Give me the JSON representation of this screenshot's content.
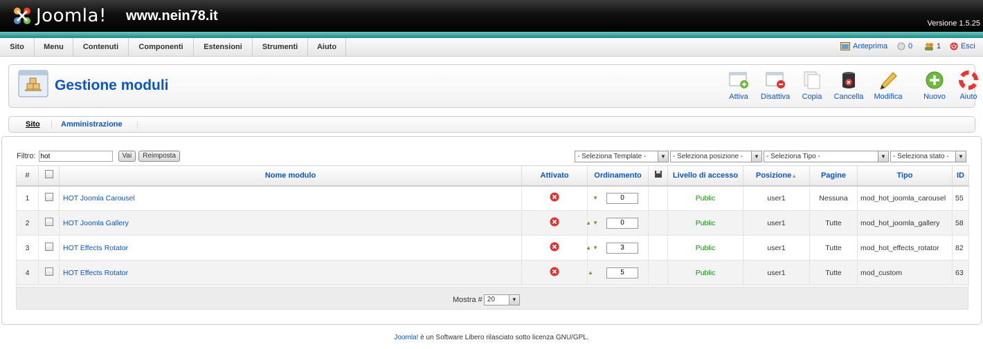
{
  "header": {
    "brand": "Joomla!",
    "site": "www.nein78.it",
    "version": "Versione 1.5.25"
  },
  "menu": [
    "Sito",
    "Menu",
    "Contenuti",
    "Componenti",
    "Estensioni",
    "Strumenti",
    "Aiuto"
  ],
  "status": {
    "preview": "Anteprima",
    "messages": "0",
    "users": "1",
    "logout": "Esci"
  },
  "toolbar": {
    "title": "Gestione moduli",
    "buttons": [
      "Attiva",
      "Disattiva",
      "Copia",
      "Cancella",
      "Modifica",
      "Nuovo",
      "Aiuto"
    ]
  },
  "subtabs": [
    "Sito",
    "Amministrazione"
  ],
  "filter": {
    "label": "Filtro:",
    "value": "hot",
    "go": "Vai",
    "reset": "Reimposta"
  },
  "selects": [
    "- Seleziona Template -",
    "- Seleziona posizione -",
    "- Seleziona Tipo -",
    "- Seleziona stato -"
  ],
  "columns": [
    "#",
    "",
    "Nome modulo",
    "Attivato",
    "Ordinamento",
    "",
    "Livello di accesso",
    "Posizione",
    "Pagine",
    "Tipo",
    "ID"
  ],
  "rows": [
    {
      "n": "1",
      "name": "HOT Joomla Carousel",
      "order": "0",
      "access": "Public",
      "pos": "user1",
      "pages": "Nessuna",
      "type": "mod_hot_joomla_carousel",
      "id": "55"
    },
    {
      "n": "2",
      "name": "HOT Joomla Gallery",
      "order": "0",
      "access": "Public",
      "pos": "user1",
      "pages": "Tutte",
      "type": "mod_hot_joomla_gallery",
      "id": "58"
    },
    {
      "n": "3",
      "name": "HOT Effects Rotator",
      "order": "3",
      "access": "Public",
      "pos": "user1",
      "pages": "Tutte",
      "type": "mod_hot_effects_rotator",
      "id": "82"
    },
    {
      "n": "4",
      "name": "HOT Effects Rotator",
      "order": "5",
      "access": "Public",
      "pos": "user1",
      "pages": "Tutte",
      "type": "mod_custom",
      "id": "63"
    }
  ],
  "footer": {
    "show_label": "Mostra #",
    "show_value": "20"
  },
  "copyright": {
    "link": "Joomla!",
    "text": " è un Software Libero rilasciato sotto licenza GNU/GPL."
  }
}
